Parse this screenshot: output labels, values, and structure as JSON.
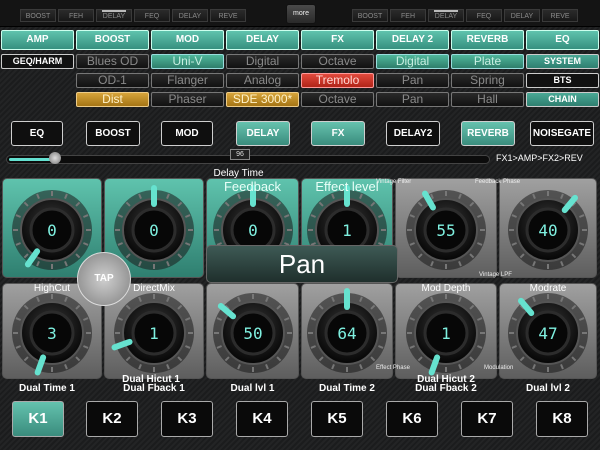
{
  "top_tabs": {
    "left": [
      "BOOST",
      "FEH",
      "DELAY",
      "FEQ",
      "DELAY",
      "REVE"
    ],
    "more_label": "more",
    "right": [
      "BOOST",
      "FEH",
      "DELAY",
      "FEQ",
      "DELAY",
      "REVE"
    ]
  },
  "effect_grid": {
    "headers": [
      "AMP",
      "BOOST",
      "MOD",
      "DELAY",
      "FX",
      "DELAY 2",
      "REVERB",
      "EQ"
    ],
    "geq_label": "GEQ/HARM",
    "system_label": "SYSTEM",
    "bts_label": "BTS",
    "chain_label": "CHAIN",
    "rows": [
      [
        "Blues OD",
        "Uni-V",
        "Digital",
        "Octave",
        "Digital",
        "Plate"
      ],
      [
        "OD-1",
        "Flanger",
        "Analog",
        "Tremolo",
        "Pan",
        "Spring"
      ],
      [
        "Dist",
        "Phaser",
        "SDE 3000*",
        "Octave",
        "Pan",
        "Hall"
      ]
    ]
  },
  "fx_buttons": [
    "EQ",
    "BOOST",
    "MOD",
    "DELAY",
    "FX",
    "DELAY2",
    "REVERB",
    "NOISEGATE"
  ],
  "slider": {
    "value_label": "96",
    "position_fraction": 0.1,
    "chain_text": "FX1>AMP>FX2>REV"
  },
  "knobs": {
    "top": [
      {
        "label": "",
        "value": "0"
      },
      {
        "label": "",
        "value": "0"
      },
      {
        "label": "Feedback",
        "value": "0"
      },
      {
        "label": "Effect level",
        "value": "1"
      },
      {
        "label": "",
        "value": "55"
      },
      {
        "label": "",
        "value": "40"
      }
    ],
    "top_titles": {
      "delay_time": "Delay Time",
      "vintage_filter": "Vintage Filter",
      "feedback_phase": "Feedback Phase"
    },
    "bottom": [
      {
        "label": "HighCut",
        "value": "3"
      },
      {
        "label": "DirectMix",
        "value": "1"
      },
      {
        "label": "",
        "value": "50"
      },
      {
        "label": "",
        "value": "64"
      },
      {
        "label": "Mod Depth",
        "value": "1"
      },
      {
        "label": "Modrate",
        "value": "47"
      }
    ],
    "extras": {
      "vintage_lpf": "Vintage LPF",
      "effect_phase": "Effect Phase",
      "modulation": "Modulation"
    }
  },
  "tap_label": "TAP",
  "big_display": "Pan",
  "dual_labels": {
    "l1": "Dual Time 1",
    "l2a": "Dual Hicut 1",
    "l2b": "Dual Fback 1",
    "l3": "Dual lvl 1",
    "l4": "Dual Time 2",
    "l5a": "Dual Hicut 2",
    "l5b": "Dual Fback 2",
    "l6": "Dual lvl 2"
  },
  "k_buttons": [
    "K1",
    "K2",
    "K3",
    "K4",
    "K5",
    "K6",
    "K7",
    "K8"
  ],
  "colors": {
    "accent": "#4fb79b",
    "active_red": "#d9382b",
    "active_yellow": "#c9932c"
  }
}
